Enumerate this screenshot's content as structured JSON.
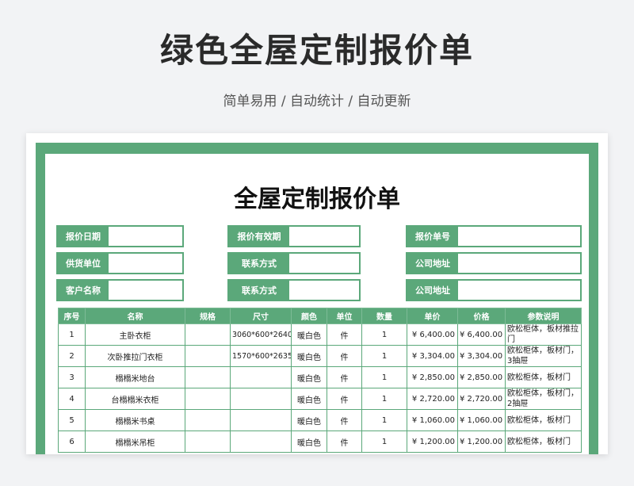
{
  "header": {
    "title": "绿色全屋定制报价单",
    "subtitle": "简单易用 / 自动统计 / 自动更新"
  },
  "sheet": {
    "title": "全屋定制报价单",
    "fields": [
      {
        "label": "报价日期",
        "value": ""
      },
      {
        "label": "报价有效期",
        "value": ""
      },
      {
        "label": "报价单号",
        "value": ""
      },
      {
        "label": "供货单位",
        "value": ""
      },
      {
        "label": "联系方式",
        "value": ""
      },
      {
        "label": "公司地址",
        "value": ""
      },
      {
        "label": "客户名称",
        "value": ""
      },
      {
        "label": "联系方式",
        "value": ""
      },
      {
        "label": "公司地址",
        "value": ""
      }
    ],
    "columns": [
      "序号",
      "名称",
      "规格",
      "尺寸",
      "颜色",
      "单位",
      "数量",
      "单价",
      "价格",
      "参数说明"
    ],
    "rows": [
      {
        "no": "1",
        "name": "主卧衣柜",
        "spec": "",
        "size": "3060*600*2640",
        "color": "暖白色",
        "unit": "件",
        "qty": "1",
        "price": "¥ 6,400.00",
        "total": "¥ 6,400.00",
        "desc": "欧松柜体，板材推拉门"
      },
      {
        "no": "2",
        "name": "次卧推拉门衣柜",
        "spec": "",
        "size": "1570*600*2635",
        "color": "暖白色",
        "unit": "件",
        "qty": "1",
        "price": "¥ 3,304.00",
        "total": "¥ 3,304.00",
        "desc": "欧松柜体，板材门，3抽屉"
      },
      {
        "no": "3",
        "name": "榻榻米地台",
        "spec": "",
        "size": "",
        "color": "暖白色",
        "unit": "件",
        "qty": "1",
        "price": "¥ 2,850.00",
        "total": "¥ 2,850.00",
        "desc": "欧松柜体，板材门"
      },
      {
        "no": "4",
        "name": "台榻榻米衣柜",
        "spec": "",
        "size": "",
        "color": "暖白色",
        "unit": "件",
        "qty": "1",
        "price": "¥ 2,720.00",
        "total": "¥ 2,720.00",
        "desc": "欧松柜体，板材门，2抽屉"
      },
      {
        "no": "5",
        "name": "榻榻米书桌",
        "spec": "",
        "size": "",
        "color": "暖白色",
        "unit": "件",
        "qty": "1",
        "price": "¥ 1,060.00",
        "total": "¥ 1,060.00",
        "desc": "欧松柜体，板材门"
      },
      {
        "no": "6",
        "name": "榻榻米吊柜",
        "spec": "",
        "size": "",
        "color": "暖白色",
        "unit": "件",
        "qty": "1",
        "price": "¥ 1,200.00",
        "total": "¥ 1,200.00",
        "desc": "欧松柜体，板材门"
      }
    ]
  },
  "colors": {
    "accent": "#5ba87a",
    "background": "#f2f3f5"
  }
}
